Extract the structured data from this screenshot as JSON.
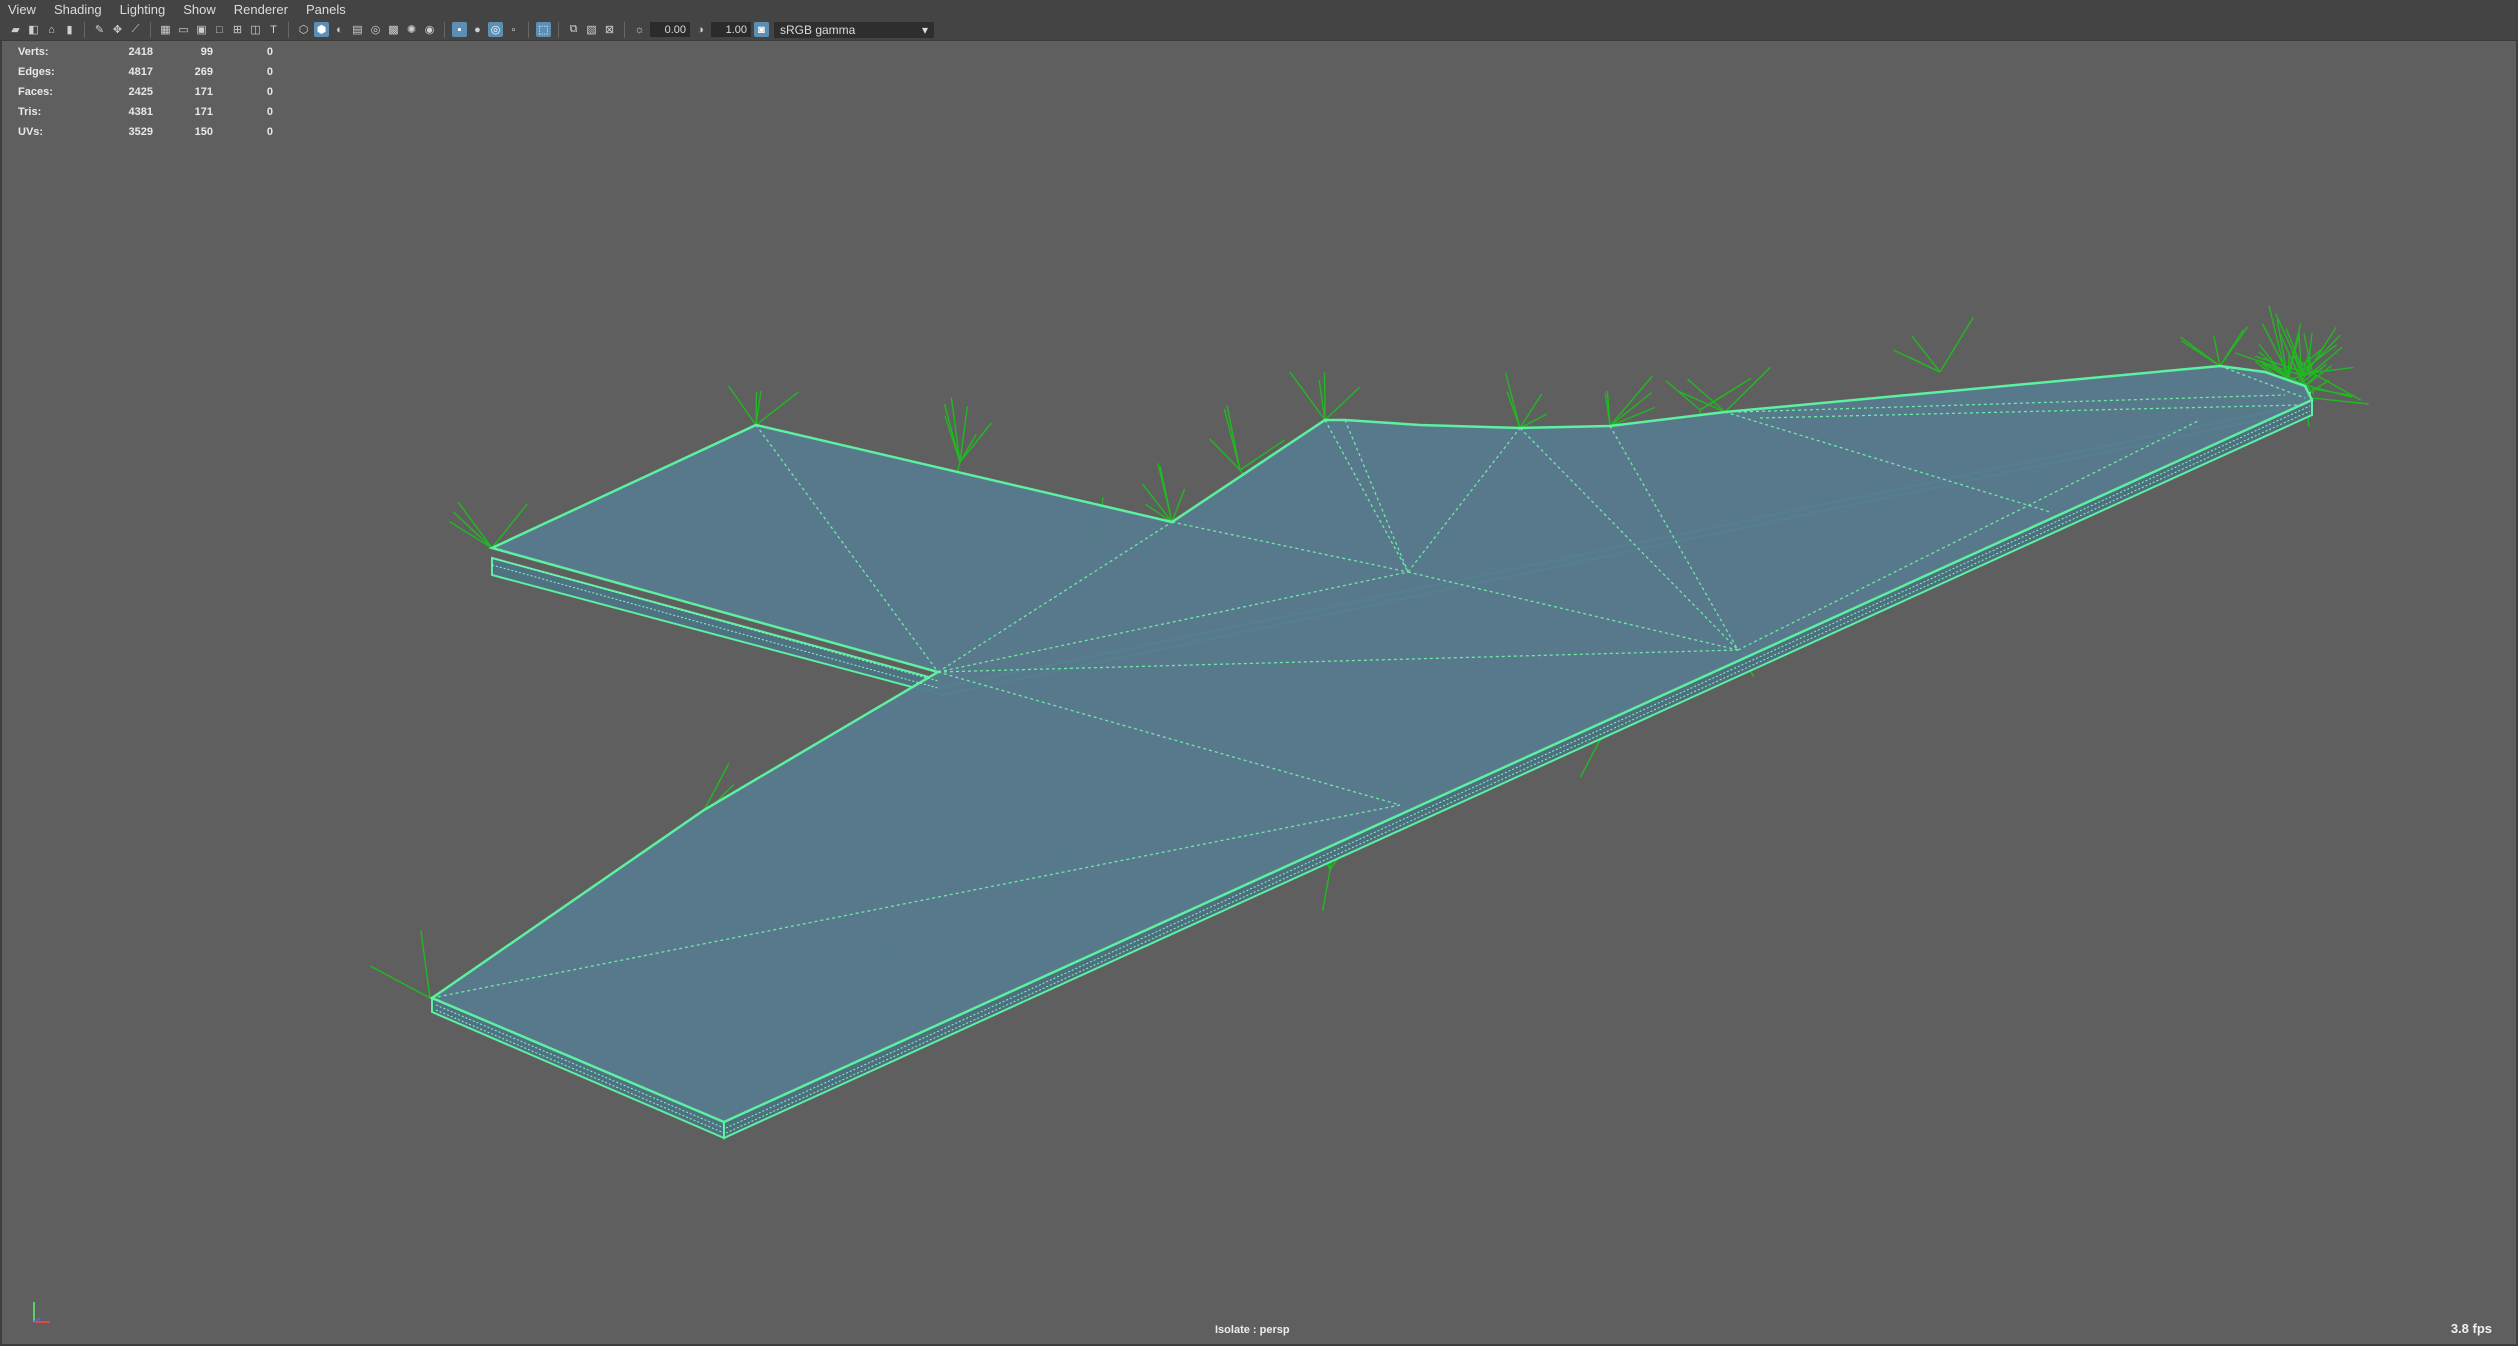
{
  "menubar": {
    "items": [
      "View",
      "Shading",
      "Lighting",
      "Show",
      "Renderer",
      "Panels"
    ]
  },
  "toolbar": {
    "icons": [
      "camera-icon",
      "camera-attributes-icon",
      "bookmark-icon",
      "image-plane-icon",
      "grease-pencil-icon",
      "select-camera-icon",
      "grid-icon",
      "film-gate-icon",
      "resolution-gate-icon",
      "gate-mask-icon",
      "field-chart-icon",
      "safe-action-icon",
      "safe-title-icon",
      "wireframe-icon",
      "smooth-shade-icon",
      "default-material-icon",
      "textured-icon",
      "use-lights-icon",
      "shadows-icon",
      "screen-space-ao-icon",
      "motion-blur-icon",
      "multisample-aa-icon",
      "depth-of-field-icon",
      "isolate-select-icon",
      "xray-icon",
      "xray-joints-icon",
      "backface-icon",
      "exposure-icon",
      "gamma-icon",
      "color-management-icon"
    ],
    "exposure_value": "0.00",
    "gamma_value": "1.00",
    "color_space": "sRGB gamma"
  },
  "hud": {
    "rows": [
      {
        "label": "Verts:",
        "v1": "2418",
        "v2": "99",
        "v3": "0"
      },
      {
        "label": "Edges:",
        "v1": "4817",
        "v2": "269",
        "v3": "0"
      },
      {
        "label": "Faces:",
        "v1": "2425",
        "v2": "171",
        "v3": "0"
      },
      {
        "label": "Tris:",
        "v1": "4381",
        "v2": "171",
        "v3": "0"
      },
      {
        "label": "UVs:",
        "v1": "3529",
        "v2": "150",
        "v3": "0"
      }
    ]
  },
  "status": {
    "isolate_label": "Isolate : persp",
    "fps": "3.8 fps"
  },
  "colors": {
    "viewport_bg": "#5f5f5f",
    "mesh_fill": "#567a8c",
    "wire_highlight": "#5df0a0",
    "normals": "#1fb81f",
    "toolbar_active": "#5d8fb5"
  }
}
